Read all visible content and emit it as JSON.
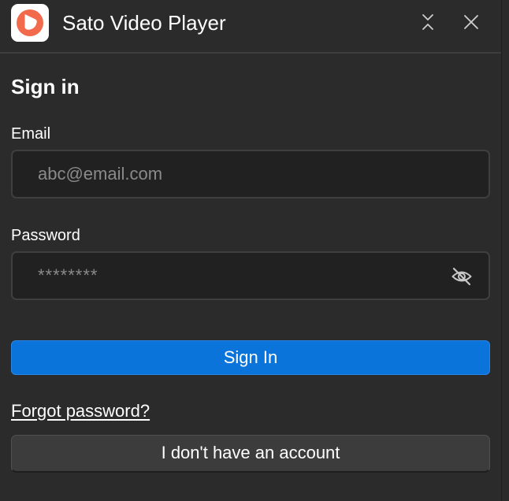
{
  "window": {
    "title": "Sato Video Player",
    "accent_color": "#f26a4b"
  },
  "form": {
    "heading": "Sign in",
    "email_label": "Email",
    "email_placeholder": "abc@email.com",
    "email_value": "",
    "password_label": "Password",
    "password_masked": "********",
    "sign_in_label": "Sign In",
    "forgot_link": "Forgot password?",
    "no_account_label": "I don't have an account"
  },
  "colors": {
    "primary_button": "#0a74da",
    "secondary_button": "#3c3c3c",
    "background": "#2b2b2b",
    "input_background": "#212121"
  },
  "icons": {
    "app": "app-logo-icon",
    "collapse": "collapse-icon",
    "close": "close-icon",
    "password_visibility": "eye-off-icon"
  }
}
